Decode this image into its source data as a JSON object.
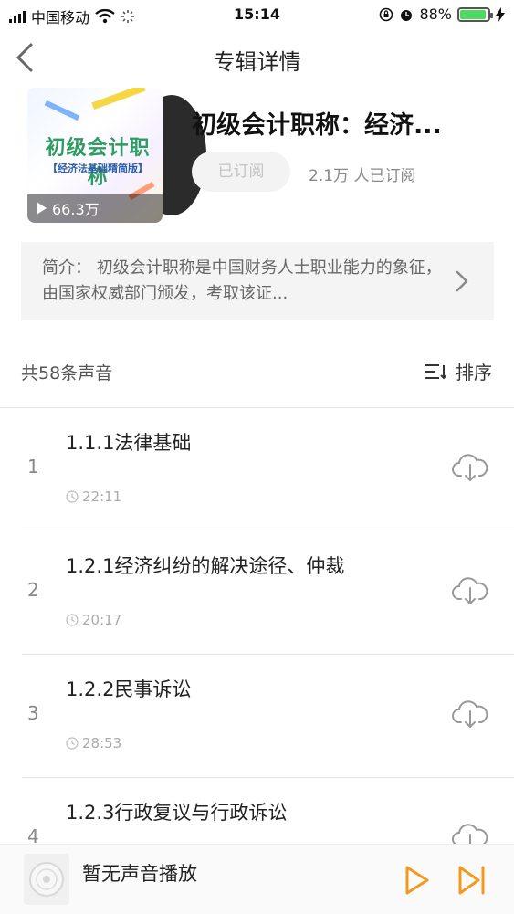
{
  "status_bar": {
    "carrier": "中国移动",
    "time": "15:14",
    "battery": "88%",
    "battery_level": 0.88
  },
  "nav": {
    "title": "专辑详情"
  },
  "album": {
    "cover_title": "初级会计职称",
    "cover_subtitle": "【经济法基础精简版】",
    "play_count": "66.3万",
    "title": "初级会计职称：经济...",
    "subscribe_label": "已订阅",
    "subscribers": "2.1万 人已订阅"
  },
  "intro": {
    "text": "简介： 初级会计职称是中国财务人士职业能力的象征，由国家权威部门颁发，考取该证..."
  },
  "list_header": {
    "count": "共58条声音",
    "sort_label": "排序"
  },
  "tracks": [
    {
      "index": "1",
      "title": "1.1.1法律基础",
      "duration": "22:11"
    },
    {
      "index": "2",
      "title": "1.2.1经济纠纷的解决途径、仲裁",
      "duration": "20:17"
    },
    {
      "index": "3",
      "title": "1.2.2民事诉讼",
      "duration": "28:53"
    },
    {
      "index": "4",
      "title": "1.2.3行政复议与行政诉讼",
      "duration": ""
    }
  ],
  "player": {
    "status": "暂无声音播放"
  },
  "colors": {
    "accent": "#f39a1e",
    "battery_green": "#4cd964"
  }
}
